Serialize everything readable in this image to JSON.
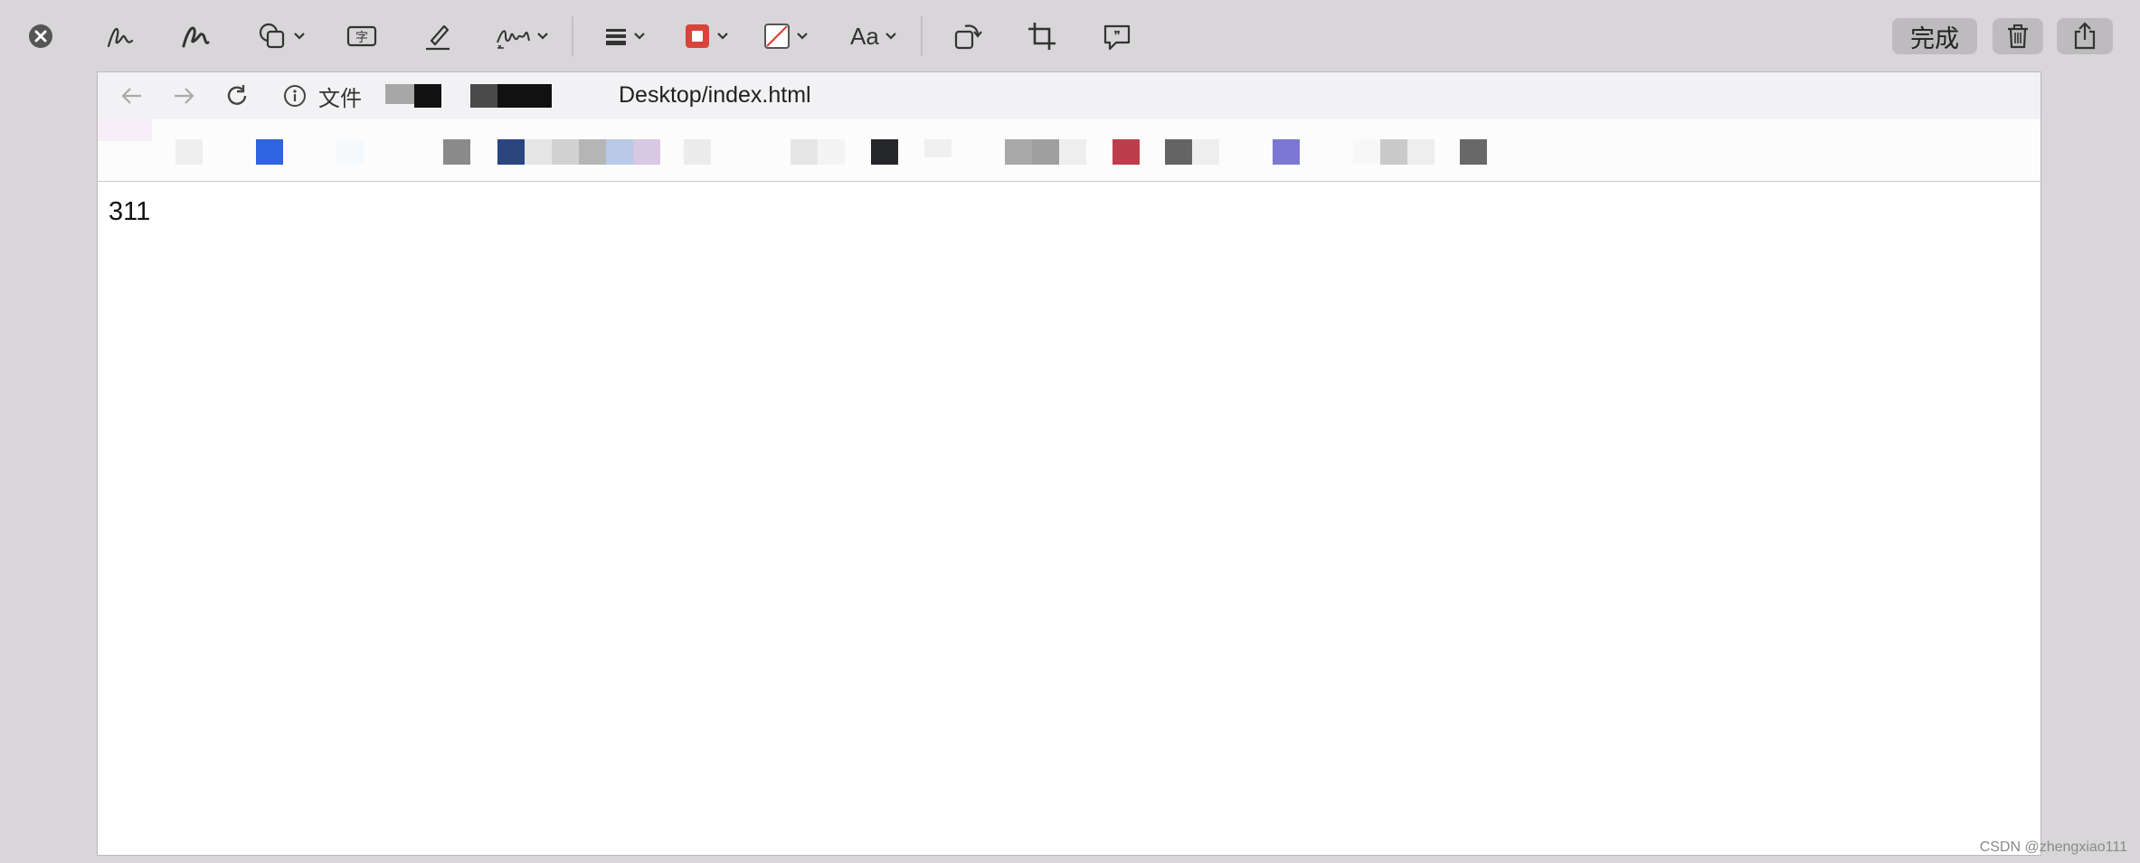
{
  "toolbar": {
    "tools": [
      {
        "name": "close",
        "icon": "close-circle-icon"
      },
      {
        "name": "sketch",
        "icon": "sketch-icon"
      },
      {
        "name": "draw",
        "icon": "draw-icon"
      },
      {
        "name": "shapes",
        "icon": "shapes-icon"
      },
      {
        "name": "text",
        "icon": "text-box-icon",
        "glyph": "字"
      },
      {
        "name": "highlight",
        "icon": "highlighter-icon"
      },
      {
        "name": "sign",
        "icon": "signature-icon"
      },
      {
        "name": "line-style",
        "icon": "line-style-icon"
      },
      {
        "name": "border-color",
        "icon": "border-color-icon",
        "color": "#d9443a"
      },
      {
        "name": "fill-color",
        "icon": "fill-color-icon",
        "color": "#d9443a"
      },
      {
        "name": "text-style",
        "icon": "text-style-icon",
        "label": "Aa"
      },
      {
        "name": "rotate",
        "icon": "rotate-icon"
      },
      {
        "name": "crop",
        "icon": "crop-icon"
      },
      {
        "name": "annotate",
        "icon": "speech-bubble-icon"
      }
    ],
    "done_label": "完成",
    "trash_icon": "trash-icon",
    "share_icon": "share-icon"
  },
  "browser": {
    "back_icon": "arrow-left-icon",
    "forward_icon": "arrow-right-icon",
    "reload_icon": "reload-icon",
    "info_icon": "info-icon",
    "file_label": "文件",
    "url": "Desktop/index.html"
  },
  "page": {
    "content": "311"
  },
  "watermark": "CSDN @zhengxiao111",
  "colors": {
    "toolbar_bg": "#d8d6d8",
    "accent_red": "#d9443a"
  }
}
